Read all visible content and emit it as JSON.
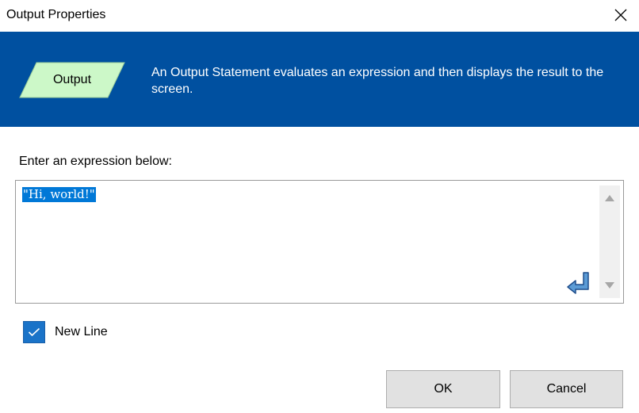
{
  "window": {
    "title": "Output Properties",
    "close_icon": "close-icon"
  },
  "banner": {
    "shape_label": "Output",
    "shape_color": "#ccf8c8",
    "background_color": "#0050a0",
    "description": "An Output Statement evaluates an expression and then displays the result to the screen."
  },
  "expression": {
    "label": "Enter an expression below:",
    "value": "\"Hi, world!\"",
    "selected": true,
    "enter_icon": "enter-return-icon"
  },
  "options": {
    "new_line_label": "New Line",
    "new_line_checked": true
  },
  "buttons": {
    "ok_label": "OK",
    "cancel_label": "Cancel"
  }
}
